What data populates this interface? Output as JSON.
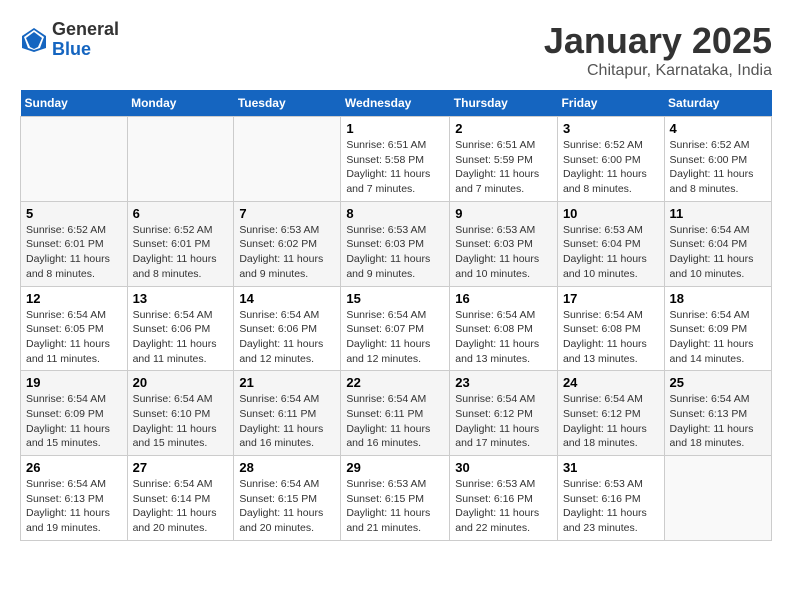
{
  "logo": {
    "general": "General",
    "blue": "Blue"
  },
  "title": "January 2025",
  "subtitle": "Chitapur, Karnataka, India",
  "weekdays": [
    "Sunday",
    "Monday",
    "Tuesday",
    "Wednesday",
    "Thursday",
    "Friday",
    "Saturday"
  ],
  "weeks": [
    [
      {
        "day": "",
        "info": ""
      },
      {
        "day": "",
        "info": ""
      },
      {
        "day": "",
        "info": ""
      },
      {
        "day": "1",
        "info": "Sunrise: 6:51 AM\nSunset: 5:58 PM\nDaylight: 11 hours\nand 7 minutes."
      },
      {
        "day": "2",
        "info": "Sunrise: 6:51 AM\nSunset: 5:59 PM\nDaylight: 11 hours\nand 7 minutes."
      },
      {
        "day": "3",
        "info": "Sunrise: 6:52 AM\nSunset: 6:00 PM\nDaylight: 11 hours\nand 8 minutes."
      },
      {
        "day": "4",
        "info": "Sunrise: 6:52 AM\nSunset: 6:00 PM\nDaylight: 11 hours\nand 8 minutes."
      }
    ],
    [
      {
        "day": "5",
        "info": "Sunrise: 6:52 AM\nSunset: 6:01 PM\nDaylight: 11 hours\nand 8 minutes."
      },
      {
        "day": "6",
        "info": "Sunrise: 6:52 AM\nSunset: 6:01 PM\nDaylight: 11 hours\nand 8 minutes."
      },
      {
        "day": "7",
        "info": "Sunrise: 6:53 AM\nSunset: 6:02 PM\nDaylight: 11 hours\nand 9 minutes."
      },
      {
        "day": "8",
        "info": "Sunrise: 6:53 AM\nSunset: 6:03 PM\nDaylight: 11 hours\nand 9 minutes."
      },
      {
        "day": "9",
        "info": "Sunrise: 6:53 AM\nSunset: 6:03 PM\nDaylight: 11 hours\nand 10 minutes."
      },
      {
        "day": "10",
        "info": "Sunrise: 6:53 AM\nSunset: 6:04 PM\nDaylight: 11 hours\nand 10 minutes."
      },
      {
        "day": "11",
        "info": "Sunrise: 6:54 AM\nSunset: 6:04 PM\nDaylight: 11 hours\nand 10 minutes."
      }
    ],
    [
      {
        "day": "12",
        "info": "Sunrise: 6:54 AM\nSunset: 6:05 PM\nDaylight: 11 hours\nand 11 minutes."
      },
      {
        "day": "13",
        "info": "Sunrise: 6:54 AM\nSunset: 6:06 PM\nDaylight: 11 hours\nand 11 minutes."
      },
      {
        "day": "14",
        "info": "Sunrise: 6:54 AM\nSunset: 6:06 PM\nDaylight: 11 hours\nand 12 minutes."
      },
      {
        "day": "15",
        "info": "Sunrise: 6:54 AM\nSunset: 6:07 PM\nDaylight: 11 hours\nand 12 minutes."
      },
      {
        "day": "16",
        "info": "Sunrise: 6:54 AM\nSunset: 6:08 PM\nDaylight: 11 hours\nand 13 minutes."
      },
      {
        "day": "17",
        "info": "Sunrise: 6:54 AM\nSunset: 6:08 PM\nDaylight: 11 hours\nand 13 minutes."
      },
      {
        "day": "18",
        "info": "Sunrise: 6:54 AM\nSunset: 6:09 PM\nDaylight: 11 hours\nand 14 minutes."
      }
    ],
    [
      {
        "day": "19",
        "info": "Sunrise: 6:54 AM\nSunset: 6:09 PM\nDaylight: 11 hours\nand 15 minutes."
      },
      {
        "day": "20",
        "info": "Sunrise: 6:54 AM\nSunset: 6:10 PM\nDaylight: 11 hours\nand 15 minutes."
      },
      {
        "day": "21",
        "info": "Sunrise: 6:54 AM\nSunset: 6:11 PM\nDaylight: 11 hours\nand 16 minutes."
      },
      {
        "day": "22",
        "info": "Sunrise: 6:54 AM\nSunset: 6:11 PM\nDaylight: 11 hours\nand 16 minutes."
      },
      {
        "day": "23",
        "info": "Sunrise: 6:54 AM\nSunset: 6:12 PM\nDaylight: 11 hours\nand 17 minutes."
      },
      {
        "day": "24",
        "info": "Sunrise: 6:54 AM\nSunset: 6:12 PM\nDaylight: 11 hours\nand 18 minutes."
      },
      {
        "day": "25",
        "info": "Sunrise: 6:54 AM\nSunset: 6:13 PM\nDaylight: 11 hours\nand 18 minutes."
      }
    ],
    [
      {
        "day": "26",
        "info": "Sunrise: 6:54 AM\nSunset: 6:13 PM\nDaylight: 11 hours\nand 19 minutes."
      },
      {
        "day": "27",
        "info": "Sunrise: 6:54 AM\nSunset: 6:14 PM\nDaylight: 11 hours\nand 20 minutes."
      },
      {
        "day": "28",
        "info": "Sunrise: 6:54 AM\nSunset: 6:15 PM\nDaylight: 11 hours\nand 20 minutes."
      },
      {
        "day": "29",
        "info": "Sunrise: 6:53 AM\nSunset: 6:15 PM\nDaylight: 11 hours\nand 21 minutes."
      },
      {
        "day": "30",
        "info": "Sunrise: 6:53 AM\nSunset: 6:16 PM\nDaylight: 11 hours\nand 22 minutes."
      },
      {
        "day": "31",
        "info": "Sunrise: 6:53 AM\nSunset: 6:16 PM\nDaylight: 11 hours\nand 23 minutes."
      },
      {
        "day": "",
        "info": ""
      }
    ]
  ]
}
